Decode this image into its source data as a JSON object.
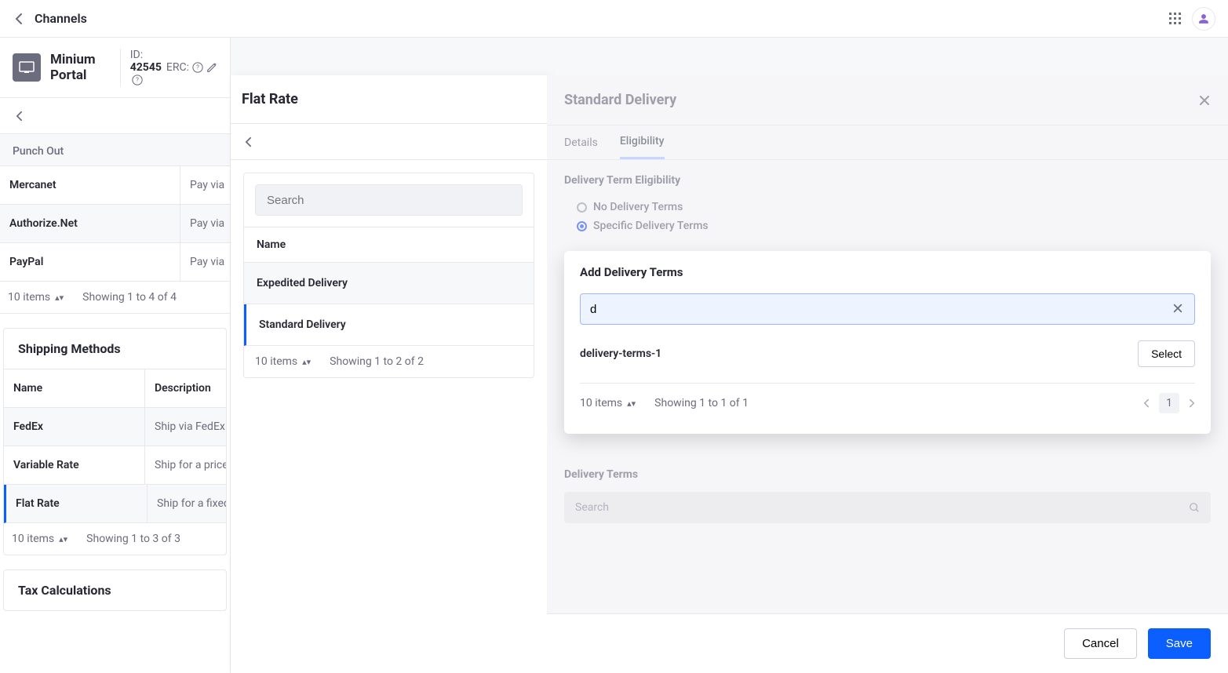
{
  "topbar": {
    "title": "Channels"
  },
  "channel": {
    "name": "Minium Portal",
    "id_label": "ID:",
    "id_value": "42545",
    "erc_label": "ERC:"
  },
  "punch_out": {
    "label": "Punch Out",
    "rows": [
      {
        "name": "Mercanet",
        "desc": "Pay via"
      },
      {
        "name": "Authorize.Net",
        "desc": "Pay via"
      },
      {
        "name": "PayPal",
        "desc": "Pay via"
      }
    ],
    "items_label": "10 items",
    "showing": "Showing 1 to 4 of 4"
  },
  "shipping": {
    "title": "Shipping Methods",
    "head_name": "Name",
    "head_desc": "Description",
    "rows": [
      {
        "name": "FedEx",
        "desc": "Ship via FedEx c"
      },
      {
        "name": "Variable Rate",
        "desc": "Ship for a price"
      },
      {
        "name": "Flat Rate",
        "desc": "Ship for a fixed"
      }
    ],
    "items_label": "10 items",
    "showing": "Showing 1 to 3 of 3"
  },
  "tax": {
    "title": "Tax Calculations"
  },
  "flat_rate": {
    "title": "Flat Rate",
    "search_placeholder": "Search",
    "head_name": "Name",
    "items": [
      {
        "name": "Expedited Delivery"
      },
      {
        "name": "Standard Delivery"
      }
    ],
    "items_label": "10 items",
    "showing": "Showing 1 to 2 of 2"
  },
  "drawer": {
    "title": "Standard Delivery",
    "tabs": {
      "details": "Details",
      "eligibility": "Eligibility"
    },
    "eligibility": {
      "title": "Delivery Term Eligibility",
      "opt_none": "No Delivery Terms",
      "opt_specific": "Specific Delivery Terms"
    },
    "add_terms": {
      "title": "Add Delivery Terms",
      "search_value": "d",
      "result": "delivery-terms-1",
      "select_label": "Select",
      "items_label": "10 items",
      "showing": "Showing 1 to 1 of 1",
      "page": "1"
    },
    "terms": {
      "title": "Delivery Terms",
      "search_placeholder": "Search"
    },
    "footer": {
      "cancel": "Cancel",
      "save": "Save"
    }
  }
}
